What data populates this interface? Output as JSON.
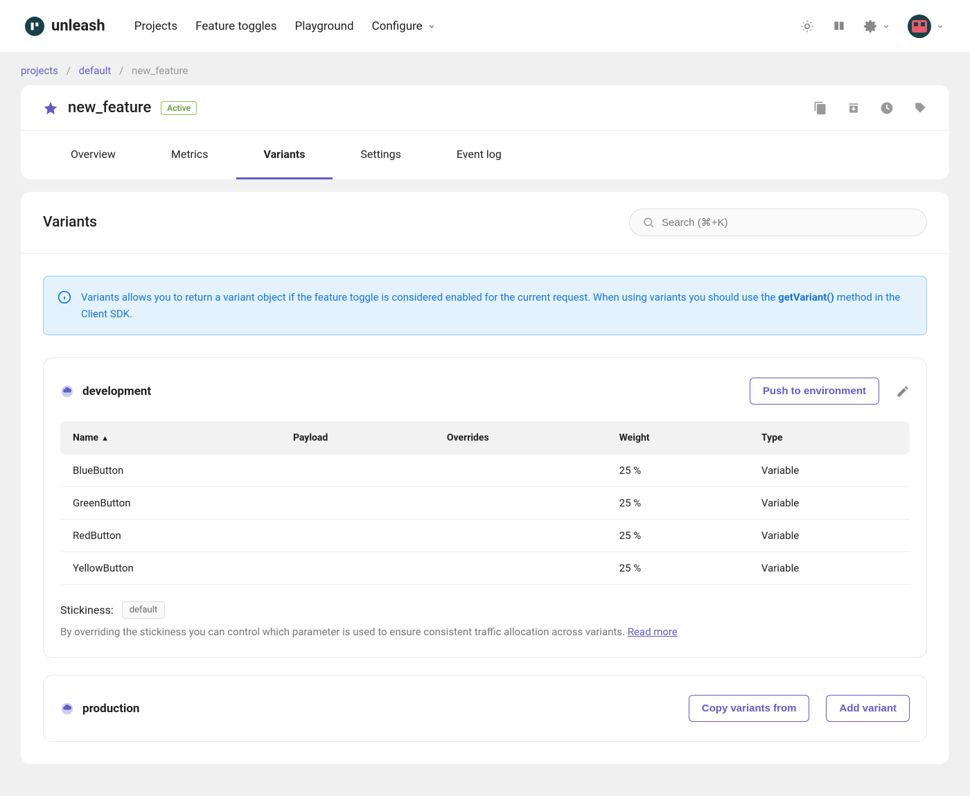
{
  "brand": "unleash",
  "nav": {
    "projects": "Projects",
    "toggles": "Feature toggles",
    "playground": "Playground",
    "configure": "Configure"
  },
  "breadcrumb": {
    "projects": "projects",
    "default": "default",
    "current": "new_feature"
  },
  "feature": {
    "name": "new_feature",
    "status": "Active"
  },
  "tabs": {
    "overview": "Overview",
    "metrics": "Metrics",
    "variants": "Variants",
    "settings": "Settings",
    "eventlog": "Event log"
  },
  "variants": {
    "title": "Variants",
    "search_placeholder": "Search (⌘+K)",
    "info_text": "Variants allows you to return a variant object if the feature toggle is considered enabled for the current request. When using variants you should use the ",
    "info_method": "getVariant()",
    "info_text2": " method in the Client SDK.",
    "columns": {
      "name": "Name",
      "payload": "Payload",
      "overrides": "Overrides",
      "weight": "Weight",
      "type": "Type"
    },
    "dev": {
      "name": "development",
      "push_btn": "Push to environment",
      "rows": [
        {
          "name": "BlueButton",
          "payload": "",
          "overrides": "",
          "weight": "25 %",
          "type": "Variable"
        },
        {
          "name": "GreenButton",
          "payload": "",
          "overrides": "",
          "weight": "25 %",
          "type": "Variable"
        },
        {
          "name": "RedButton",
          "payload": "",
          "overrides": "",
          "weight": "25 %",
          "type": "Variable"
        },
        {
          "name": "YellowButton",
          "payload": "",
          "overrides": "",
          "weight": "25 %",
          "type": "Variable"
        }
      ],
      "stickiness_label": "Stickiness:",
      "stickiness_value": "default",
      "stickiness_desc": "By overriding the stickiness you can control which parameter is used to ensure consistent traffic allocation across variants. ",
      "stickiness_link": "Read more"
    },
    "prod": {
      "name": "production",
      "copy_btn": "Copy variants from",
      "add_btn": "Add variant"
    }
  }
}
